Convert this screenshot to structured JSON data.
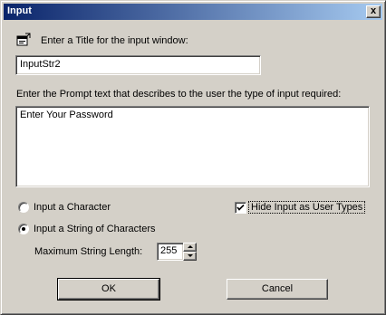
{
  "window": {
    "title": "Input",
    "close_glyph": "x"
  },
  "title_section": {
    "label": "Enter a Title for the input window:",
    "value": "InputStr2",
    "icon": "window-properties-icon"
  },
  "prompt_section": {
    "label": "Enter the Prompt text that describes to the user the type of input required:",
    "value": "Enter Your Password"
  },
  "options": {
    "radio_character": {
      "label": "Input a Character",
      "selected": false
    },
    "radio_string": {
      "label": "Input a String of Characters",
      "selected": true
    },
    "hide_input": {
      "label": "Hide Input as User Types",
      "checked": true
    },
    "max_length": {
      "label": "Maximum String Length:",
      "value": "255"
    }
  },
  "buttons": {
    "ok": "OK",
    "cancel": "Cancel"
  },
  "colors": {
    "titlebar_start": "#0a246a",
    "titlebar_end": "#a6caf0",
    "face": "#d4d0c8"
  }
}
